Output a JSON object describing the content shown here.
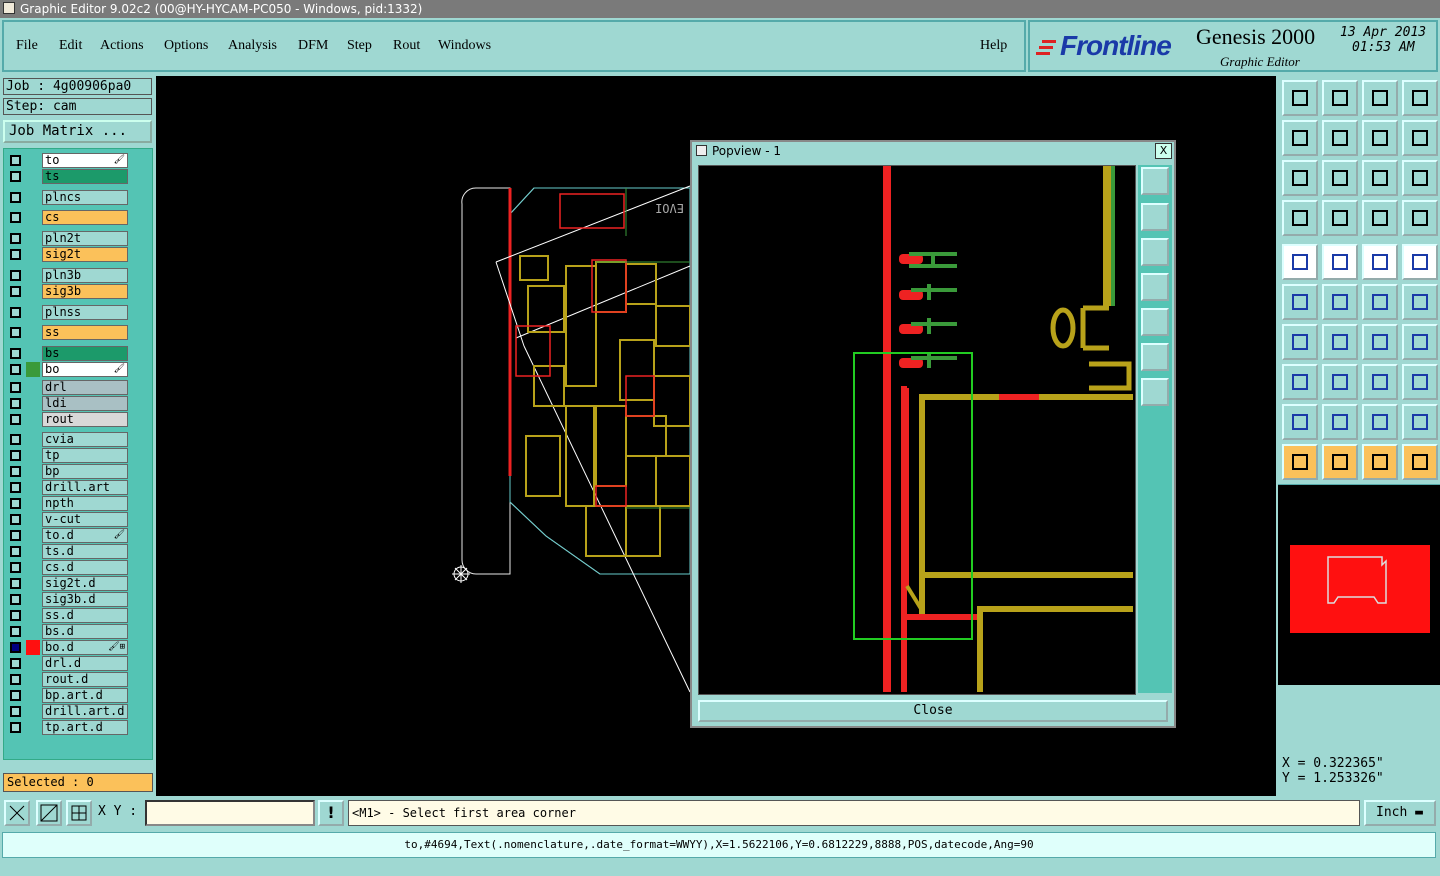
{
  "window": {
    "title": "Graphic Editor 9.02c2 (00@HY-HYCAM-PC050 - Windows, pid:1332)"
  },
  "menu": [
    "File",
    "Edit",
    "Actions",
    "Options",
    "Analysis",
    "DFM",
    "Step",
    "Rout",
    "Windows"
  ],
  "help_label": "Help",
  "brand": {
    "logo": "Frontline",
    "product": "Genesis 2000",
    "subtitle": "Graphic Editor",
    "date": "13 Apr 2013",
    "time": "01:53 AM"
  },
  "job": {
    "job_label": "Job : 4g00906pa0",
    "step_label": "Step: cam",
    "matrix_button": "Job Matrix ..."
  },
  "layers": [
    {
      "name": "to",
      "color": "#ffffff",
      "mark": "🖌"
    },
    {
      "name": "ts",
      "color": "#1c9a6a"
    },
    {
      "name": "plncs",
      "color": "#9fd8d2"
    },
    {
      "name": "cs",
      "color": "#fbc15a"
    },
    {
      "name": "pln2t",
      "color": "#9fd8d2"
    },
    {
      "name": "sig2t",
      "color": "#fbc15a"
    },
    {
      "name": "pln3b",
      "color": "#9fd8d2"
    },
    {
      "name": "sig3b",
      "color": "#fbc15a"
    },
    {
      "name": "plnss",
      "color": "#9fd8d2"
    },
    {
      "name": "ss",
      "color": "#fbc15a"
    },
    {
      "name": "bs",
      "color": "#1c9a6a"
    },
    {
      "name": "bo",
      "color": "#ffffff",
      "mark": "🖌"
    },
    {
      "name": "drl",
      "color": "#a9c0c4"
    },
    {
      "name": "ldi",
      "color": "#a9c0c4"
    },
    {
      "name": "rout",
      "color": "#d8d8d8"
    },
    {
      "name": "cvia",
      "color": "#9fd8d2"
    },
    {
      "name": "tp",
      "color": "#9fd8d2"
    },
    {
      "name": "bp",
      "color": "#9fd8d2"
    },
    {
      "name": "drill.art",
      "color": "#9fd8d2"
    },
    {
      "name": "npth",
      "color": "#9fd8d2"
    },
    {
      "name": "v-cut",
      "color": "#9fd8d2"
    },
    {
      "name": "to.d",
      "color": "#9fd8d2",
      "mark": "🖌"
    },
    {
      "name": "ts.d",
      "color": "#9fd8d2"
    },
    {
      "name": "cs.d",
      "color": "#9fd8d2"
    },
    {
      "name": "sig2t.d",
      "color": "#9fd8d2"
    },
    {
      "name": "sig3b.d",
      "color": "#9fd8d2"
    },
    {
      "name": "ss.d",
      "color": "#9fd8d2"
    },
    {
      "name": "bs.d",
      "color": "#9fd8d2"
    },
    {
      "name": "bo.d",
      "color": "#9fd8d2",
      "mark": "🖌⊞",
      "active": true
    },
    {
      "name": "drl.d",
      "color": "#9fd8d2"
    },
    {
      "name": "rout.d",
      "color": "#9fd8d2"
    },
    {
      "name": "bp.art.d",
      "color": "#9fd8d2"
    },
    {
      "name": "drill.art.d",
      "color": "#9fd8d2"
    },
    {
      "name": "tp.art.d",
      "color": "#9fd8d2"
    }
  ],
  "selected_label": "Selected : 0",
  "popview": {
    "title": "Popview - 1",
    "close_label": "Close",
    "close_x": "X"
  },
  "coords": {
    "x": "X = 0.322365\"",
    "y": "Y = 1.253326\""
  },
  "bottom": {
    "xy_label": "X Y :",
    "xy_value": "",
    "message": "<M1> - Select first area corner",
    "unit": "Inch"
  },
  "status_line": "to,#4694,Text(.nomenclature,.date_format=WWYY),X=1.5622106,Y=0.6812229,8888,POS,datecode,Ang=90"
}
